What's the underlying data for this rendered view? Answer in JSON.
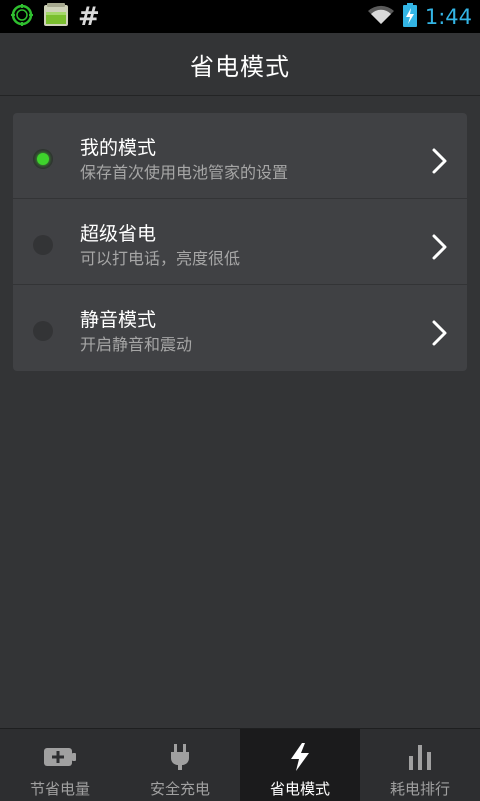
{
  "status_bar": {
    "time": "1:44",
    "hash_symbol": "#",
    "icons": [
      "clock-app-icon",
      "battery-app-icon",
      "hash-icon",
      "wifi-icon",
      "battery-charging-icon"
    ]
  },
  "header": {
    "title": "省电模式"
  },
  "modes": [
    {
      "name": "我的模式",
      "desc": "保存首次使用电池管家的设置",
      "selected": true
    },
    {
      "name": "超级省电",
      "desc": "可以打电话，亮度很低",
      "selected": false
    },
    {
      "name": "静音模式",
      "desc": "开启静音和震动",
      "selected": false
    }
  ],
  "tabs": [
    {
      "label": "节省电量",
      "icon": "battery-plus-icon",
      "active": false
    },
    {
      "label": "安全充电",
      "icon": "plug-icon",
      "active": false
    },
    {
      "label": "省电模式",
      "icon": "lightning-icon",
      "active": true
    },
    {
      "label": "耗电排行",
      "icon": "bar-chart-icon",
      "active": false
    }
  ],
  "colors": {
    "background": "#333436",
    "accent_time": "#33b5e5",
    "selected_dot": "#3ed32c"
  }
}
